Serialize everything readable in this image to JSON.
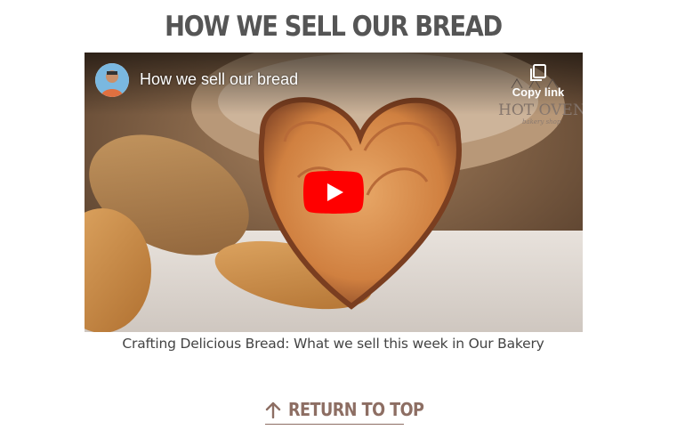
{
  "section": {
    "heading": "HOW WE SELL OUR BREAD"
  },
  "video": {
    "title": "How we sell our bread",
    "copy_link_label": "Copy link",
    "watermark_brand": "HOT OVEN",
    "watermark_sub": "bakery shop",
    "play_icon": "youtube-play-icon",
    "accent_color": "#ff0000"
  },
  "caption": "Crafting Delicious Bread: What we sell this week in Our Bakery",
  "footer": {
    "return_label": "RETURN TO TOP",
    "return_icon": "arrow-up-icon",
    "link_color": "#8d6e63"
  }
}
